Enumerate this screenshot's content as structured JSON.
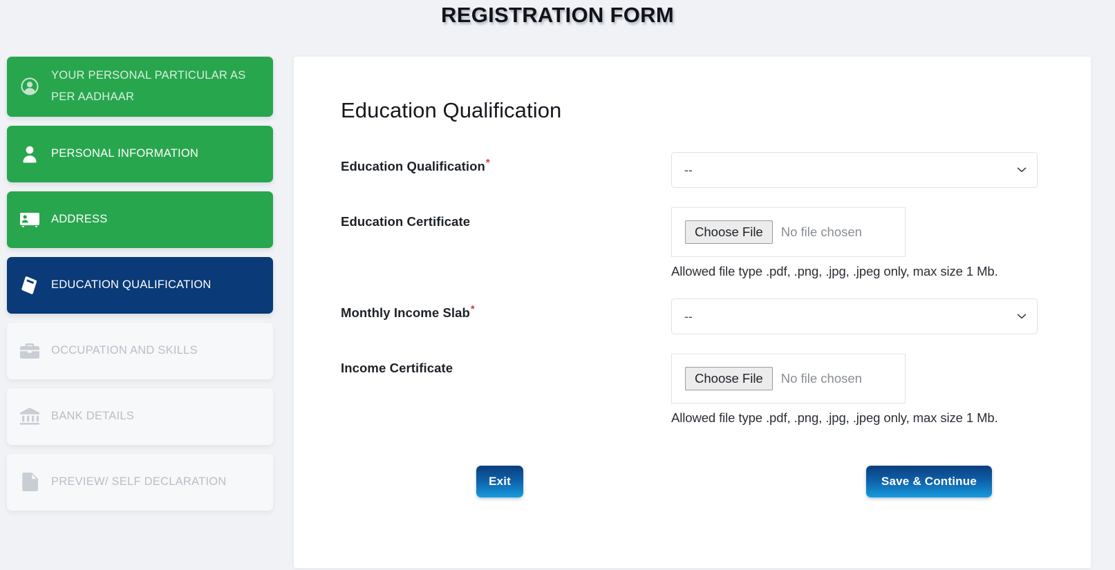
{
  "header": {
    "title": "REGISTRATION FORM"
  },
  "sidebar": {
    "items": [
      {
        "label": "YOUR PERSONAL PARTICULAR AS PER AADHAAR",
        "icon": "user-circle-icon",
        "state": "done"
      },
      {
        "label": "PERSONAL INFORMATION",
        "icon": "user-icon",
        "state": "done"
      },
      {
        "label": "ADDRESS",
        "icon": "id-card-icon",
        "state": "done"
      },
      {
        "label": "EDUCATION QUALIFICATION",
        "icon": "book-icon",
        "state": "active"
      },
      {
        "label": "OCCUPATION AND SKILLS",
        "icon": "briefcase-icon",
        "state": "disabled"
      },
      {
        "label": "BANK DETAILS",
        "icon": "bank-icon",
        "state": "disabled"
      },
      {
        "label": "PREVIEW/ SELF DECLARATION",
        "icon": "document-icon",
        "state": "disabled"
      }
    ]
  },
  "main": {
    "section_title": "Education Qualification",
    "fields": {
      "education_qualification": {
        "label": "Education Qualification",
        "required_marker": "*",
        "value": "--"
      },
      "education_certificate": {
        "label": "Education Certificate",
        "choose_file_label": "Choose File",
        "file_status": "No file chosen",
        "hint": "Allowed file type .pdf, .png, .jpg, .jpeg only, max size 1 Mb."
      },
      "monthly_income_slab": {
        "label": "Monthly Income Slab",
        "required_marker": "*",
        "value": "--"
      },
      "income_certificate": {
        "label": "Income Certificate",
        "choose_file_label": "Choose File",
        "file_status": "No file chosen",
        "hint": "Allowed file type .pdf, .png, .jpg, .jpeg only, max size 1 Mb."
      }
    },
    "actions": {
      "exit_label": "Exit",
      "save_label": "Save & Continue"
    }
  },
  "colors": {
    "step_done": "#28a64d",
    "step_active": "#0a3a77",
    "step_disabled": "#f7f8fa",
    "required_red": "#e0333f",
    "button_gradient_start": "#0b3f7d",
    "button_gradient_end": "#179bdb",
    "page_background": "#f0f2f5"
  }
}
